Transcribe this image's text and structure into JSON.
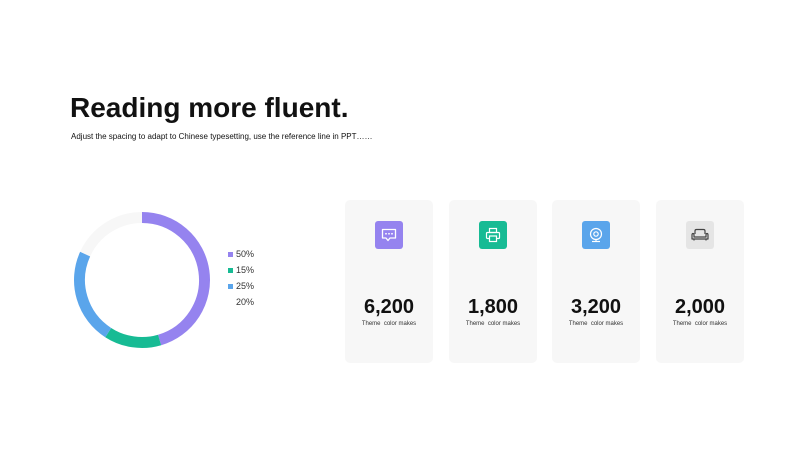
{
  "header": {
    "title": "Reading more fluent.",
    "subtitle": "Adjust the spacing to adapt to Chinese typesetting, use the reference line in PPT……"
  },
  "colors": {
    "purple": "#9583ef",
    "green": "#17bb94",
    "blue": "#5aa5eb",
    "light_gray": "#f7f7f7",
    "icon_gray": "#e5e5e5"
  },
  "donut": {
    "segments": [
      {
        "label": "50%",
        "value": 50,
        "color": "#9583ef"
      },
      {
        "label": "15%",
        "value": 15,
        "color": "#17bb94"
      },
      {
        "label": "25%",
        "value": 25,
        "color": "#5aa5eb"
      },
      {
        "label": "20%",
        "value": 20,
        "color": "#f7f7f7"
      }
    ]
  },
  "cards": [
    {
      "value": "6,200",
      "caption": "Theme  color makes",
      "icon": "chat-bubble-icon",
      "icon_bg": "#9583ef"
    },
    {
      "value": "1,800",
      "caption": "Theme  color makes",
      "icon": "printer-icon",
      "icon_bg": "#17bb94"
    },
    {
      "value": "3,200",
      "caption": "Theme  color makes",
      "icon": "webcam-icon",
      "icon_bg": "#5aa5eb"
    },
    {
      "value": "2,000",
      "caption": "Theme  color makes",
      "icon": "sofa-icon",
      "icon_bg": "#e5e5e5"
    }
  ]
}
